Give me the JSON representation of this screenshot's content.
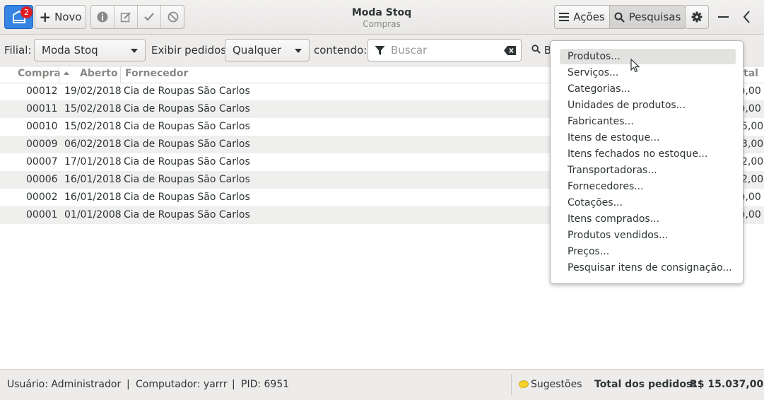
{
  "header": {
    "badge_count": "2",
    "new_button": "Novo",
    "title": "Moda Stoq",
    "subtitle": "Compras",
    "actions_button": "Ações",
    "search_button": "Pesquisas"
  },
  "filter": {
    "branch_label": "Filial:",
    "branch_value": "Moda Stoq",
    "show_orders_label": "Exibir pedidos",
    "show_orders_value": "Qualquer",
    "containing_label": "contendo:",
    "search_placeholder": "Buscar",
    "find_partial": "B"
  },
  "table": {
    "headers": [
      "Compra",
      "Aberto",
      "Fornecedor",
      "tal"
    ],
    "rows": [
      {
        "id": "00012",
        "date": "19/02/2018",
        "supplier": "Cia de Roupas São Carlos",
        "total": "),00"
      },
      {
        "id": "00011",
        "date": "15/02/2018",
        "supplier": "Cia de Roupas São Carlos",
        "total": "),00"
      },
      {
        "id": "00010",
        "date": "15/02/2018",
        "supplier": "Cia de Roupas São Carlos",
        "total": "5,00"
      },
      {
        "id": "00009",
        "date": "06/02/2018",
        "supplier": "Cia de Roupas São Carlos",
        "total": "3,00"
      },
      {
        "id": "00007",
        "date": "17/01/2018",
        "supplier": "Cia de Roupas São Carlos",
        "total": "2,00"
      },
      {
        "id": "00006",
        "date": "16/01/2018",
        "supplier": "Cia de Roupas São Carlos",
        "total": "2,00"
      },
      {
        "id": "00002",
        "date": "16/01/2018",
        "supplier": "Cia de Roupas São Carlos",
        "total": "),00"
      },
      {
        "id": "00001",
        "date": "01/01/2008",
        "supplier": "Cia de Roupas São Carlos",
        "total": "),00"
      }
    ]
  },
  "menu": {
    "items": [
      "Produtos...",
      "Serviços...",
      "Categorias...",
      "Unidades de produtos...",
      "Fabricantes...",
      "Itens de estoque...",
      "Itens fechados no estoque...",
      "Transportadoras...",
      "Fornecedores...",
      "Cotações...",
      "Itens comprados...",
      "Produtos vendidos...",
      "Preços...",
      "Pesquisar itens de consignação..."
    ]
  },
  "status": {
    "user": "Usuário: Administrador",
    "sep1": "|",
    "computer": "Computador: yarrr",
    "sep2": "|",
    "pid": "PID: 6951",
    "suggestions": "Sugestões",
    "total_label": "Total dos pedidos:",
    "total_value": "R$ 15.037,00"
  },
  "colors": {
    "accent": "#3584e4",
    "badge": "#e01b24"
  }
}
